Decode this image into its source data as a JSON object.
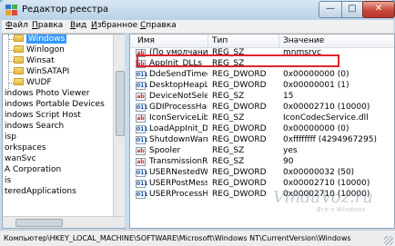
{
  "window": {
    "title": "Редактор реестра",
    "min_glyph": "—",
    "max_glyph": "□",
    "close_glyph": "✕"
  },
  "menu": [
    "Файл",
    "Правка",
    "Вид",
    "Избранное",
    "Справка"
  ],
  "tree": {
    "items": [
      {
        "label": "Windows",
        "selected": true
      },
      {
        "label": "Winlogon"
      },
      {
        "label": "Winsat"
      },
      {
        "label": "WinSATAPI"
      },
      {
        "label": "WUDF"
      },
      {
        "label": "indows Photo Viewer"
      },
      {
        "label": "indows Portable Devices"
      },
      {
        "label": "indows Script Host"
      },
      {
        "label": "indows Search"
      },
      {
        "label": "isp"
      },
      {
        "label": "orkspaces"
      },
      {
        "label": "wanSvc"
      },
      {
        "label": "A Corporation"
      },
      {
        "label": "is"
      },
      {
        "label": "teredApplications"
      }
    ]
  },
  "list": {
    "columns": [
      "Имя",
      "Тип",
      "Значение"
    ],
    "rows": [
      {
        "name": "(По умолчанию)",
        "type": "REG_SZ",
        "value": "mnmsrvc",
        "kind": "sz"
      },
      {
        "name": "AppInit_DLLs",
        "type": "REG_SZ",
        "value": "",
        "kind": "sz"
      },
      {
        "name": "DdeSendTimeout",
        "type": "REG_DWORD",
        "value": "0x00000000 (0)",
        "kind": "dword"
      },
      {
        "name": "DesktopHeapLo...",
        "type": "REG_DWORD",
        "value": "0x00000001 (1)",
        "kind": "dword"
      },
      {
        "name": "DeviceNotSelect...",
        "type": "REG_SZ",
        "value": "15",
        "kind": "sz"
      },
      {
        "name": "GDIProcessHan...",
        "type": "REG_DWORD",
        "value": "0x00002710 (10000)",
        "kind": "dword"
      },
      {
        "name": "IconServiceLib",
        "type": "REG_SZ",
        "value": "IconCodecService.dll",
        "kind": "sz"
      },
      {
        "name": "LoadAppInit_DLLs",
        "type": "REG_DWORD",
        "value": "0x00000000 (0)",
        "kind": "dword"
      },
      {
        "name": "ShutdownWarni...",
        "type": "REG_DWORD",
        "value": "0xffffffff (4294967295)",
        "kind": "dword"
      },
      {
        "name": "Spooler",
        "type": "REG_SZ",
        "value": "yes",
        "kind": "sz"
      },
      {
        "name": "TransmissionRet...",
        "type": "REG_SZ",
        "value": "90",
        "kind": "sz"
      },
      {
        "name": "USERNestedWin...",
        "type": "REG_DWORD",
        "value": "0x00000032 (50)",
        "kind": "dword"
      },
      {
        "name": "USERPostMessa...",
        "type": "REG_DWORD",
        "value": "0x00002710 (10000)",
        "kind": "dword"
      },
      {
        "name": "USERProcessHa...",
        "type": "REG_DWORD",
        "value": "0x00002710 (10000)",
        "kind": "dword"
      }
    ],
    "icon_sz": "ab",
    "icon_dword": "011"
  },
  "status": "Компьютер\\HKEY_LOCAL_MACHINE\\SOFTWARE\\Microsoft\\Windows NT\\CurrentVersion\\Windows",
  "watermark": {
    "main": "VindaVoz.ru",
    "sub": "Всё о Windows"
  },
  "colors": {
    "highlight_border": "#e0242a",
    "selection": "#3399ff"
  }
}
